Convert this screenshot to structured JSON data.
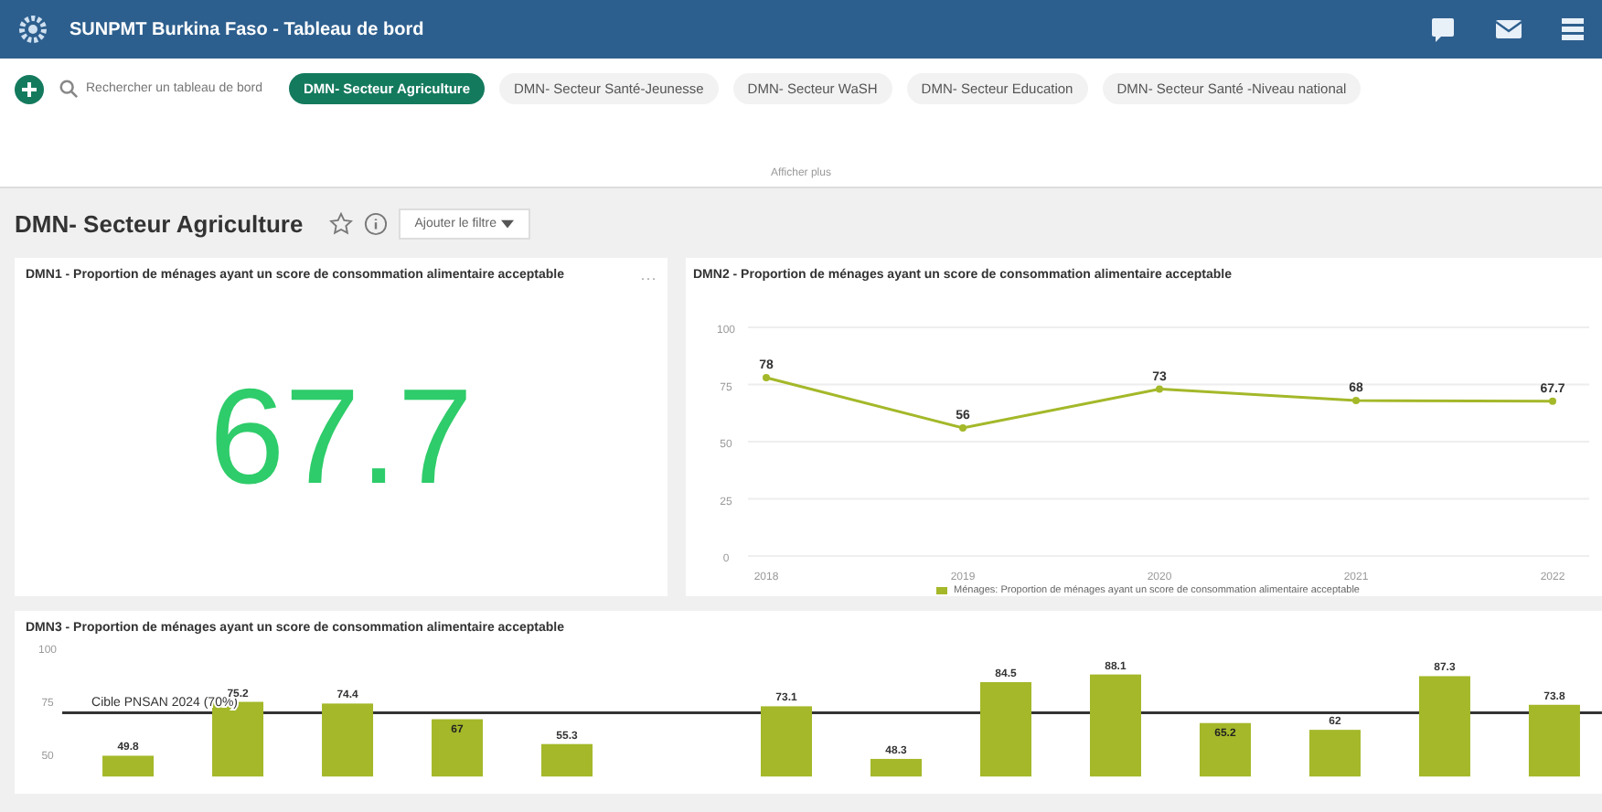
{
  "header": {
    "title": "SUNPMT Burkina Faso - Tableau de bord"
  },
  "search": {
    "placeholder": "Rechercher un tableau de bord"
  },
  "tabs": [
    {
      "label": "DMN- Secteur Agriculture",
      "selected": true
    },
    {
      "label": "DMN- Secteur Santé-Jeunesse",
      "selected": false
    },
    {
      "label": "DMN- Secteur WaSH",
      "selected": false
    },
    {
      "label": "DMN- Secteur Education",
      "selected": false
    },
    {
      "label": "DMN- Secteur Santé -Niveau national",
      "selected": false
    }
  ],
  "show_more": "Afficher plus",
  "dashboard": {
    "title": "DMN- Secteur Agriculture",
    "filter_button": "Ajouter le filtre"
  },
  "kpi": {
    "title": "DMN1 - Proportion de ménages ayant un score de consommation alimentaire acceptable",
    "menu": "···",
    "value": "67.7"
  },
  "line_card": {
    "title": "DMN2 - Proportion de ménages ayant un score de consommation alimentaire acceptable",
    "chart_data": {
      "type": "line",
      "x": [
        "2018",
        "2019",
        "2020",
        "2021",
        "2022"
      ],
      "ylim": [
        0,
        100
      ],
      "yticks": [
        0,
        25,
        50,
        75,
        100
      ],
      "grid": true,
      "data_labels": true,
      "series": [
        {
          "name": "Ménages: Proportion de ménages ayant un score de consommation alimentaire acceptable",
          "color": "#a4b829",
          "marker": "circle",
          "values": [
            78,
            56,
            73,
            68,
            67.7
          ]
        }
      ]
    }
  },
  "bar_card": {
    "title": "DMN3 - Proportion de ménages ayant un score de consommation alimentaire acceptable",
    "chart_data": {
      "type": "bar",
      "ylim": [
        40,
        100
      ],
      "yticks": [
        50,
        75,
        100
      ],
      "data_labels": true,
      "series": [
        {
          "color": "#a4b829",
          "values": [
            49.8,
            75.2,
            74.4,
            67,
            55.3,
            null,
            73.1,
            48.3,
            84.5,
            88.1,
            65.2,
            62,
            87.3,
            73.8
          ]
        }
      ],
      "ref_lines": [
        {
          "axis": "y",
          "value": 70,
          "label": "Cible PNSAN 2024 (70%)"
        }
      ]
    }
  }
}
